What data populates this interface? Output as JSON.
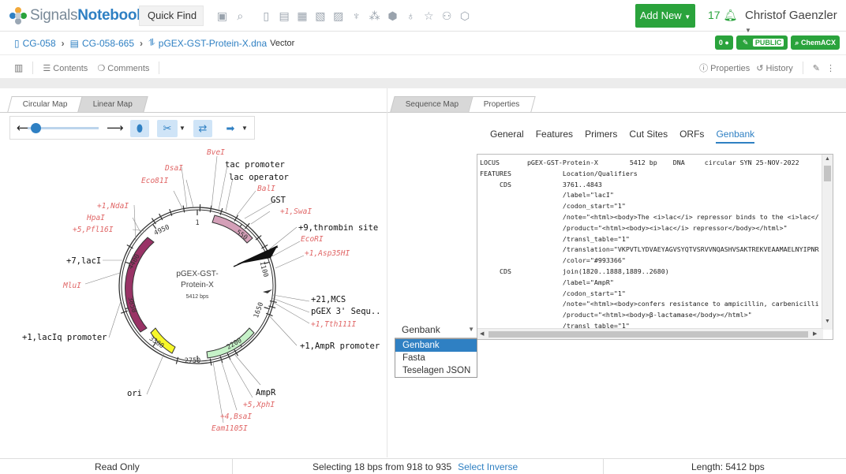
{
  "header": {
    "logo_brand_plain": "Signals",
    "logo_brand_bold": "Notebook",
    "quick_find_label": "Quick Find",
    "add_new_label": "Add New",
    "notification_count": "17",
    "user_name": "Christof Gaenzler",
    "tool_icons": [
      "sidebar-icon",
      "search-icon",
      "page-icon",
      "notebook-icon",
      "calendar-icon",
      "image-icon",
      "clipboard-icon",
      "microscope-icon",
      "molecule-icon",
      "hexagon-icon",
      "flask-icon",
      "star-icon",
      "group-icon",
      "cube-icon"
    ]
  },
  "breadcrumb": {
    "items": [
      "CG-058",
      "CG-058-665",
      "pGEX-GST-Protein-X.dna"
    ],
    "type_label": "Vector",
    "badges": {
      "comments_count": "0",
      "public_label": "PUBLIC",
      "chemacx_label": "ChemACX"
    }
  },
  "contents_bar": {
    "contents_label": "Contents",
    "comments_label": "Comments",
    "properties_label": "Properties",
    "history_label": "History"
  },
  "left_pane": {
    "tabs": [
      "Circular Map",
      "Linear Map"
    ],
    "map": {
      "name_line1": "pGEX-GST-",
      "name_line2": "Protein-X",
      "length_label": "5412 bps",
      "position_labels": [
        "1",
        "550",
        "1100",
        "1650",
        "2200",
        "2750",
        "3300",
        "3850",
        "4400",
        "4950"
      ],
      "feature_labels": [
        "tac promoter",
        "lac operator",
        "GST",
        "+9,thrombin site",
        "+21,MCS",
        "pGEX 3' Sequ..",
        "+1,AmpR promoter",
        "AmpR",
        "ori",
        "+1,lacIq promoter",
        "+7,lacI"
      ],
      "enzyme_labels": [
        "BveI",
        "DsaI",
        "Eco81I",
        "BalI",
        "+1,SwaI",
        "EcoRI",
        "+1,Asp35HI",
        "+1,NdaI",
        "HpaI",
        "+5,Pfl16I",
        "MluI",
        "+1,Tth111I",
        "+5,XphI",
        "+4,BsaI",
        "Eam1105I"
      ]
    }
  },
  "right_pane": {
    "tabs": [
      "Sequence Map",
      "Properties"
    ],
    "prop_tabs": [
      "General",
      "Features",
      "Primers",
      "Cut Sites",
      "ORFs",
      "Genbank"
    ],
    "genbank_lines": [
      "LOCUS       pGEX-GST-Protein-X        5412 bp    DNA     circular SYN 25-NOV-2022",
      "FEATURES             Location/Qualifiers",
      "     CDS             3761..4843",
      "                     /label=\"lacI\"",
      "                     /codon_start=\"1\"",
      "                     /note=\"<html><body>The <i>lac</i> repressor binds to the <i>lac</",
      "                     /product=\"<html><body><i>lac</i> repressor</body></html>\"",
      "                     /transl_table=\"1\"",
      "                     /translation=\"VKPVTLYDVAEYAGVSYQTVSRVVNQASHVSAKTREKVEAAMAELNYIPNR",
      "                     /color=\"#993366\"",
      "     CDS             join(1820..1888,1889..2680)",
      "                     /label=\"AmpR\"",
      "                     /codon_start=\"1\"",
      "                     /note=\"<html><body>confers resistance to ampicillin, carbenicilli",
      "                     /product=\"<html><body>β-lactamase</body></html>\"",
      "                     /transl_table=\"1\""
    ],
    "format_select": {
      "value": "Genbank",
      "options": [
        "Genbank",
        "Fasta",
        "Teselagen JSON"
      ]
    }
  },
  "status_bar": {
    "read_only": "Read Only",
    "selection": "Selecting 18 bps from 918 to 935",
    "select_inverse": "Select Inverse",
    "length": "Length: 5412 bps"
  },
  "colors": {
    "brand_blue": "#2f80c3",
    "add_new_green": "#2aa33c",
    "enzyme_red": "#e06666",
    "gst_feature": "#d4a0b8",
    "lacI_feature": "#993366",
    "ampR_feature": "#c6f2c8",
    "ori_feature": "#f7f72a"
  }
}
